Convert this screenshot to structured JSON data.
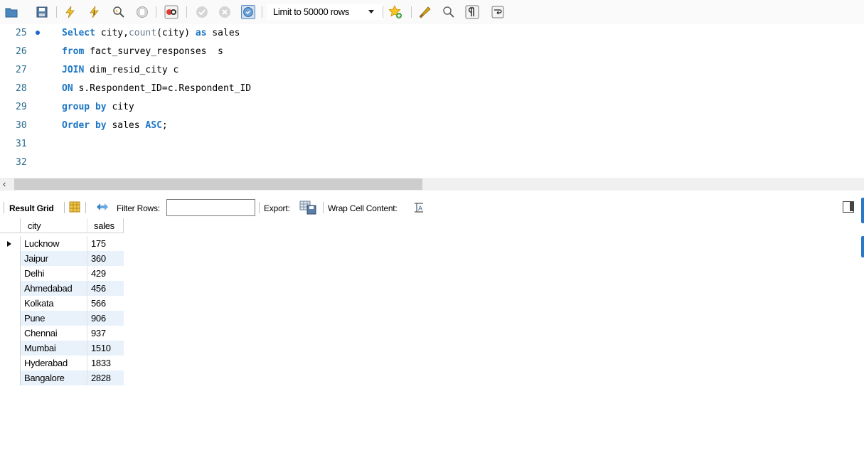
{
  "toolbar": {
    "icons": [
      "open-folder-icon",
      "save-icon",
      "execute-icon",
      "execute-current-icon",
      "explain-icon",
      "stop-icon",
      "toggle-error-icon",
      "commit-icon",
      "rollback-icon",
      "autocommit-icon",
      "add-snippet-icon",
      "beautify-icon",
      "find-icon",
      "invisible-chars-icon",
      "wrap-lines-icon"
    ],
    "limit_label": "Limit to 50000 rows"
  },
  "editor": {
    "lines": [
      {
        "number": "25"
      },
      {
        "number": "26"
      },
      {
        "number": "27"
      },
      {
        "number": "28"
      },
      {
        "number": "29"
      },
      {
        "number": "30"
      },
      {
        "number": "31"
      },
      {
        "number": "32"
      }
    ],
    "code": {
      "l25_kw1": "Select",
      "l25_t1": " city,",
      "l25_fn": "count",
      "l25_t2": "(city) ",
      "l25_kw2": "as",
      "l25_t3": " sales",
      "l26_kw": "from",
      "l26_t": " fact_survey_responses  s",
      "l27_kw": "JOIN",
      "l27_t": " dim_resid_city c",
      "l28_kw": "ON",
      "l28_t": " s.Respondent_ID=c.Respondent_ID",
      "l29_kw": "group by",
      "l29_t": " city",
      "l30_kw1": "Order by",
      "l30_t": " sales ",
      "l30_kw2": "ASC",
      "l30_end": ";"
    }
  },
  "result_bar": {
    "result_grid_label": "Result Grid",
    "filter_label": "Filter Rows:",
    "filter_value": "",
    "export_label": "Export:",
    "wrap_label": "Wrap Cell Content:"
  },
  "grid": {
    "columns": [
      "city",
      "sales"
    ],
    "rows": [
      {
        "city": "Lucknow",
        "sales": "175"
      },
      {
        "city": "Jaipur",
        "sales": "360"
      },
      {
        "city": "Delhi",
        "sales": "429"
      },
      {
        "city": "Ahmedabad",
        "sales": "456"
      },
      {
        "city": "Kolkata",
        "sales": "566"
      },
      {
        "city": "Pune",
        "sales": "906"
      },
      {
        "city": "Chennai",
        "sales": "937"
      },
      {
        "city": "Mumbai",
        "sales": "1510"
      },
      {
        "city": "Hyderabad",
        "sales": "1833"
      },
      {
        "city": "Bangalore",
        "sales": "2828"
      }
    ]
  }
}
